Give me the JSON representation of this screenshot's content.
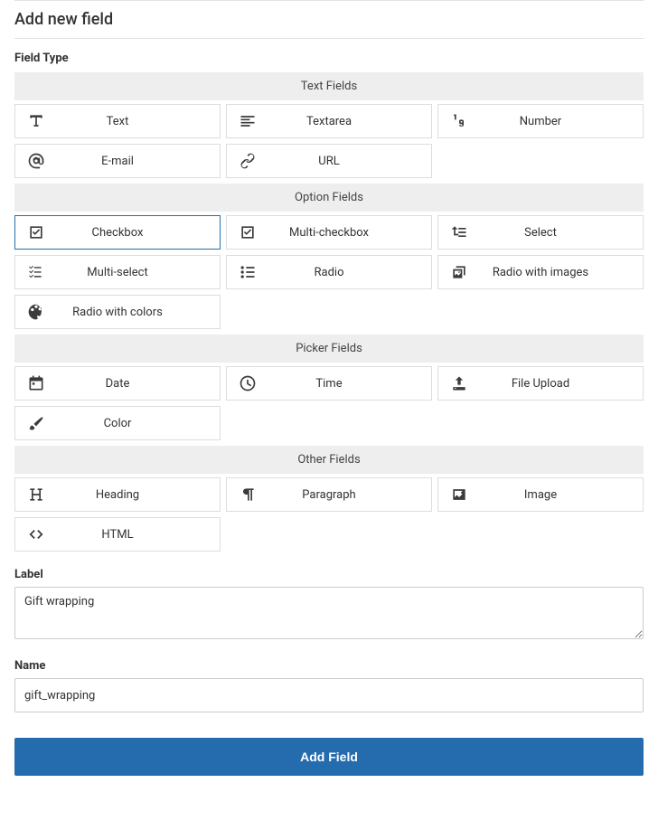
{
  "title": "Add new field",
  "fieldTypeLabel": "Field Type",
  "groups": [
    {
      "id": "text",
      "title": "Text Fields",
      "items": [
        {
          "id": "text",
          "label": "Text",
          "icon": "font",
          "selected": false
        },
        {
          "id": "textarea",
          "label": "Textarea",
          "icon": "lines-left",
          "selected": false
        },
        {
          "id": "number",
          "label": "Number",
          "icon": "one-nine",
          "selected": false
        },
        {
          "id": "email",
          "label": "E-mail",
          "icon": "at",
          "selected": false
        },
        {
          "id": "url",
          "label": "URL",
          "icon": "link",
          "selected": false
        }
      ]
    },
    {
      "id": "option",
      "title": "Option Fields",
      "items": [
        {
          "id": "checkbox",
          "label": "Checkbox",
          "icon": "checkbox",
          "selected": true
        },
        {
          "id": "multicheckbox",
          "label": "Multi-checkbox",
          "icon": "checkbox",
          "selected": false
        },
        {
          "id": "select",
          "label": "Select",
          "icon": "select",
          "selected": false
        },
        {
          "id": "multiselect",
          "label": "Multi-select",
          "icon": "checklist",
          "selected": false
        },
        {
          "id": "radio",
          "label": "Radio",
          "icon": "bullet-list",
          "selected": false
        },
        {
          "id": "radioimages",
          "label": "Radio with images",
          "icon": "images",
          "selected": false
        },
        {
          "id": "radiocolors",
          "label": "Radio with colors",
          "icon": "palette",
          "selected": false
        }
      ]
    },
    {
      "id": "picker",
      "title": "Picker Fields",
      "items": [
        {
          "id": "date",
          "label": "Date",
          "icon": "calendar",
          "selected": false
        },
        {
          "id": "time",
          "label": "Time",
          "icon": "clock",
          "selected": false
        },
        {
          "id": "fileupload",
          "label": "File Upload",
          "icon": "upload",
          "selected": false
        },
        {
          "id": "color",
          "label": "Color",
          "icon": "brush",
          "selected": false
        }
      ]
    },
    {
      "id": "other",
      "title": "Other Fields",
      "items": [
        {
          "id": "heading",
          "label": "Heading",
          "icon": "heading",
          "selected": false
        },
        {
          "id": "paragraph",
          "label": "Paragraph",
          "icon": "pilcrow",
          "selected": false
        },
        {
          "id": "image",
          "label": "Image",
          "icon": "image",
          "selected": false
        },
        {
          "id": "html",
          "label": "HTML",
          "icon": "code",
          "selected": false
        }
      ]
    }
  ],
  "label": {
    "title": "Label",
    "value": "Gift wrapping"
  },
  "name": {
    "title": "Name",
    "value": "gift_wrapping"
  },
  "submitLabel": "Add Field"
}
